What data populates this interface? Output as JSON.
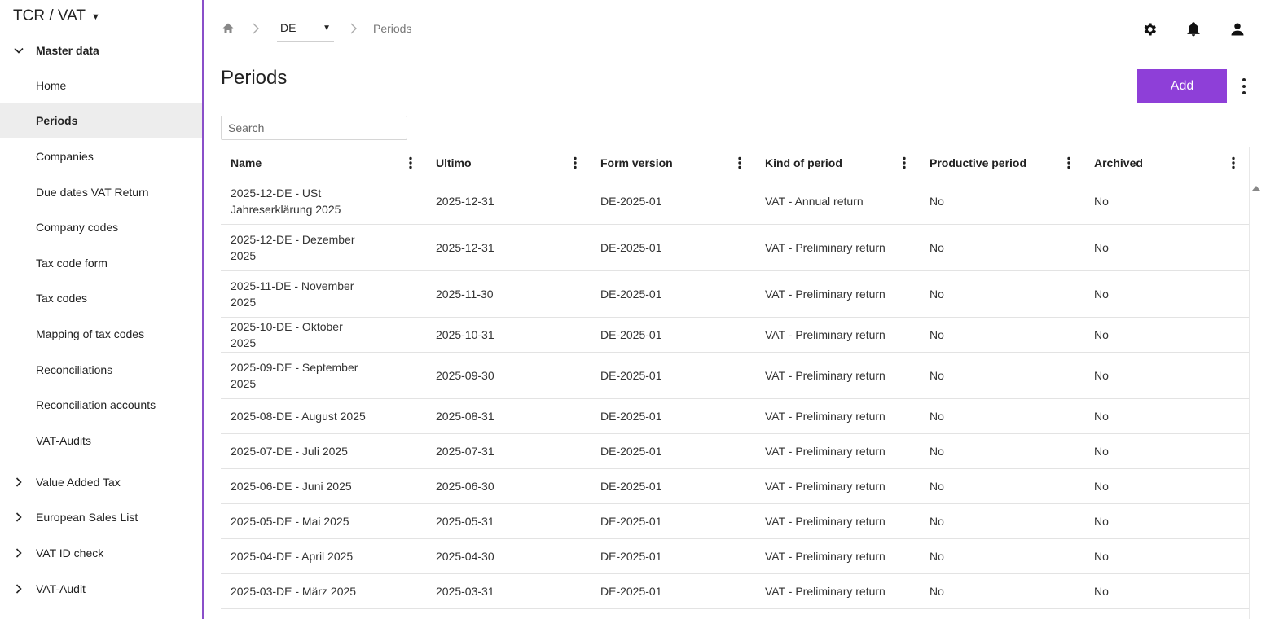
{
  "app": {
    "title": "TCR / VAT"
  },
  "sidebar": {
    "master_group": "Master data",
    "items": [
      {
        "label": "Home",
        "active": false
      },
      {
        "label": "Periods",
        "active": true
      },
      {
        "label": "Companies",
        "active": false
      },
      {
        "label": "Due dates VAT Return",
        "active": false
      },
      {
        "label": "Company codes",
        "active": false
      },
      {
        "label": "Tax code form",
        "active": false
      },
      {
        "label": "Tax codes",
        "active": false
      },
      {
        "label": "Mapping of tax codes",
        "active": false
      },
      {
        "label": "Reconciliations",
        "active": false
      },
      {
        "label": "Reconciliation accounts",
        "active": false
      },
      {
        "label": "VAT-Audits",
        "active": false
      }
    ],
    "groups": [
      {
        "label": "Value Added Tax"
      },
      {
        "label": "European Sales List"
      },
      {
        "label": "VAT ID check"
      },
      {
        "label": "VAT-Audit"
      }
    ]
  },
  "breadcrumb": {
    "country": "DE",
    "current": "Periods"
  },
  "page": {
    "title": "Periods",
    "add_label": "Add",
    "search_placeholder": "Search"
  },
  "table": {
    "columns": [
      "Name",
      "Ultimo",
      "Form version",
      "Kind of period",
      "Productive period",
      "Archived"
    ],
    "rows": [
      [
        "2025-12-DE - USt Jahreserklärung 2025",
        "2025-12-31",
        "DE-2025-01",
        "VAT - Annual return",
        "No",
        "No"
      ],
      [
        "2025-12-DE - Dezember 2025",
        "2025-12-31",
        "DE-2025-01",
        "VAT - Preliminary return",
        "No",
        "No"
      ],
      [
        "2025-11-DE - November 2025",
        "2025-11-30",
        "DE-2025-01",
        "VAT - Preliminary return",
        "No",
        "No"
      ],
      [
        "2025-10-DE - Oktober 2025",
        "2025-10-31",
        "DE-2025-01",
        "VAT - Preliminary return",
        "No",
        "No"
      ],
      [
        "2025-09-DE - September 2025",
        "2025-09-30",
        "DE-2025-01",
        "VAT - Preliminary return",
        "No",
        "No"
      ],
      [
        "2025-08-DE - August 2025",
        "2025-08-31",
        "DE-2025-01",
        "VAT - Preliminary return",
        "No",
        "No"
      ],
      [
        "2025-07-DE - Juli 2025",
        "2025-07-31",
        "DE-2025-01",
        "VAT - Preliminary return",
        "No",
        "No"
      ],
      [
        "2025-06-DE - Juni 2025",
        "2025-06-30",
        "DE-2025-01",
        "VAT - Preliminary return",
        "No",
        "No"
      ],
      [
        "2025-05-DE - Mai 2025",
        "2025-05-31",
        "DE-2025-01",
        "VAT - Preliminary return",
        "No",
        "No"
      ],
      [
        "2025-04-DE - April 2025",
        "2025-04-30",
        "DE-2025-01",
        "VAT - Preliminary return",
        "No",
        "No"
      ],
      [
        "2025-03-DE - März 2025",
        "2025-03-31",
        "DE-2025-01",
        "VAT - Preliminary return",
        "No",
        "No"
      ]
    ]
  },
  "colors": {
    "accent": "#8e3fd8",
    "sidebar_border": "#8a4fc9",
    "active_bg": "#ededed"
  },
  "icons": [
    "home-icon",
    "chevron-right-icon",
    "settings-icon",
    "bell-icon",
    "user-icon",
    "more-vert-icon",
    "chevron-down-icon"
  ]
}
